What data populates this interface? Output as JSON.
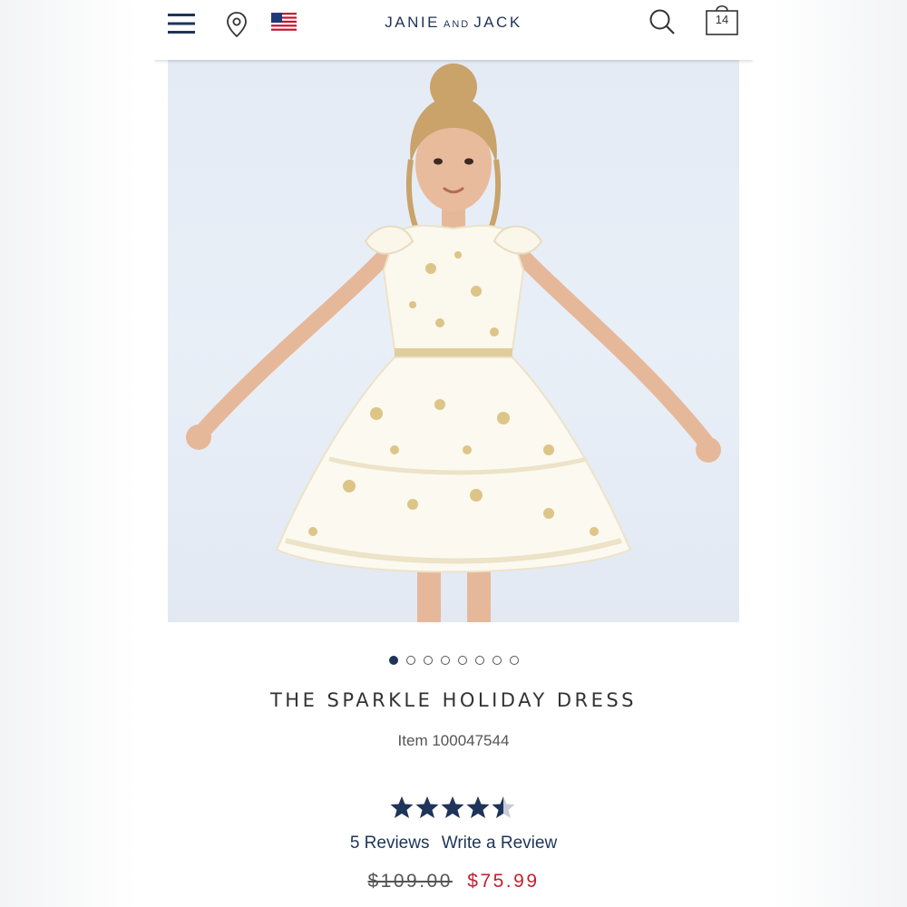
{
  "header": {
    "logo_left": "JANIE",
    "logo_mid": "AND",
    "logo_right": "JACK",
    "cart_count": "14"
  },
  "icons": {
    "menu": "hamburger-menu-icon",
    "location": "location-pin-icon",
    "flag": "us-flag-icon",
    "search": "search-icon",
    "cart": "shopping-bag-icon"
  },
  "colors": {
    "brand_navy": "#1f3459",
    "sale_red": "#c41f2f"
  },
  "carousel": {
    "total": 8,
    "active_index": 0
  },
  "product": {
    "title": "THE SPARKLE HOLIDAY DRESS",
    "item_number": "Item 100047544",
    "rating": 4.5,
    "rating_max": 5,
    "reviews_link": "5 Reviews",
    "write_review_link": "Write a Review",
    "original_price": "$109.00",
    "sale_price": "$75.99"
  }
}
